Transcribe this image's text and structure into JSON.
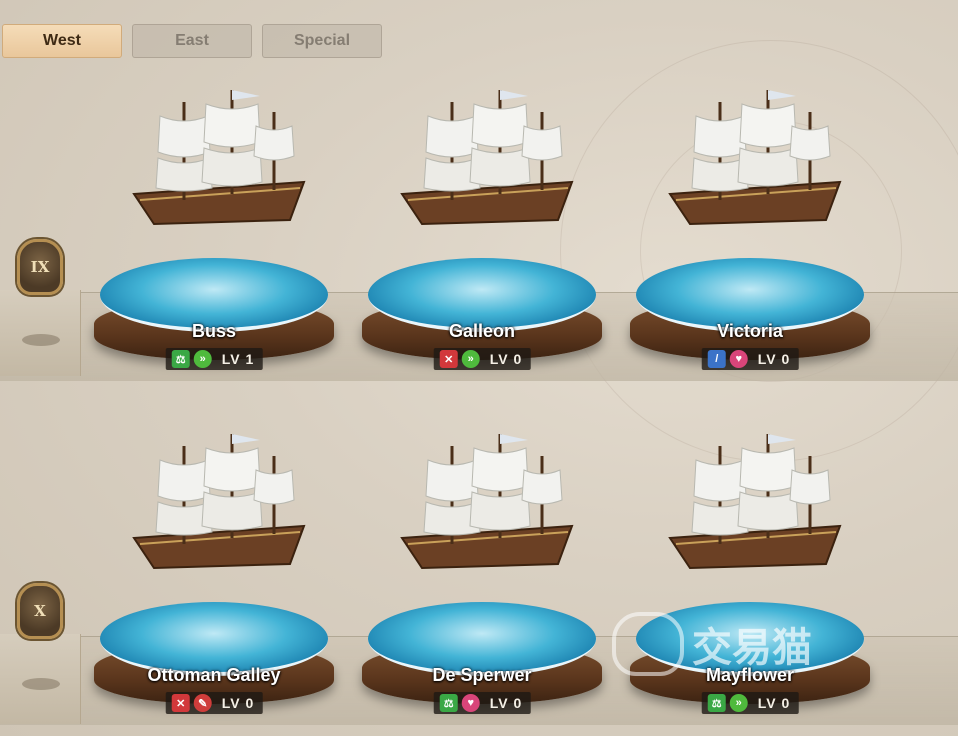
{
  "tabs": [
    {
      "label": "West",
      "active": true
    },
    {
      "label": "East",
      "active": false
    },
    {
      "label": "Special",
      "active": false
    }
  ],
  "tiers": [
    {
      "numeral": "IX"
    },
    {
      "numeral": "X"
    }
  ],
  "ships": [
    {
      "name": "Buss",
      "level": "LV 1",
      "stat_icons": [
        "balance-icon",
        "speed-icon"
      ],
      "icon_colors": [
        "#3aa845",
        "#4fba3d"
      ]
    },
    {
      "name": "Galleon",
      "level": "LV 0",
      "stat_icons": [
        "crossed-swords-icon",
        "speed-icon"
      ],
      "icon_colors": [
        "#d2383b",
        "#4fba3d"
      ]
    },
    {
      "name": "Victoria",
      "level": "LV 0",
      "stat_icons": [
        "telescope-icon",
        "heart-icon"
      ],
      "icon_colors": [
        "#3b73c8",
        "#d9457a"
      ]
    },
    {
      "name": "Ottoman Galley",
      "level": "LV 0",
      "stat_icons": [
        "crossed-swords-icon",
        "flame-icon"
      ],
      "icon_colors": [
        "#d2383b",
        "#cf3d3b"
      ]
    },
    {
      "name": "De Sperwer",
      "level": "LV 0",
      "stat_icons": [
        "balance-icon",
        "heart-icon"
      ],
      "icon_colors": [
        "#3aa845",
        "#d9457a"
      ]
    },
    {
      "name": "Mayflower",
      "level": "LV 0",
      "stat_icons": [
        "balance-icon",
        "speed-icon"
      ],
      "icon_colors": [
        "#3aa845",
        "#4fba3d"
      ]
    }
  ],
  "watermark": {
    "text": "交易猫"
  },
  "colors": {
    "active_tab": "#efd2aa",
    "sea": "#2a9cc6",
    "pedestal": "#5a351c"
  }
}
